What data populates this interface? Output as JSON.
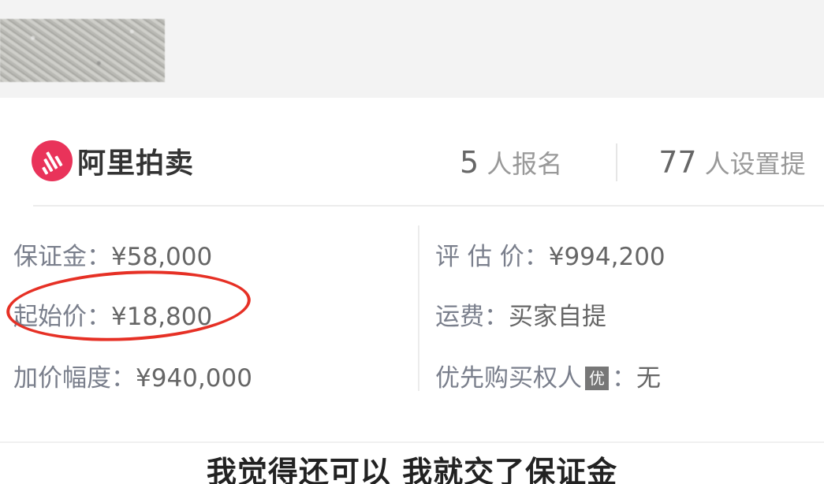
{
  "brand": {
    "name": "阿里拍卖",
    "logo_icon": "auction-gavel-icon",
    "color": "#e9335a"
  },
  "stats": {
    "signups_count": "5",
    "signups_label": "人报名",
    "reminders_count": "77",
    "reminders_label": "人设置提"
  },
  "details": {
    "deposit": {
      "label": "保证金：",
      "value": "¥58,000"
    },
    "starting_price": {
      "label": "起始价：",
      "value": "¥18,800"
    },
    "increment": {
      "label": "加价幅度：",
      "value": "¥940,000"
    },
    "appraisal": {
      "label": "评 估 价：",
      "value": "¥994,200"
    },
    "shipping": {
      "label": "运费：",
      "value": "买家自提"
    },
    "priority_buyer": {
      "label": "优先购买权人",
      "badge": "优",
      "sep": "：",
      "value": "无"
    }
  },
  "highlight_color": "#e63025",
  "subtitle": "我觉得还可以  我就交了保证金"
}
